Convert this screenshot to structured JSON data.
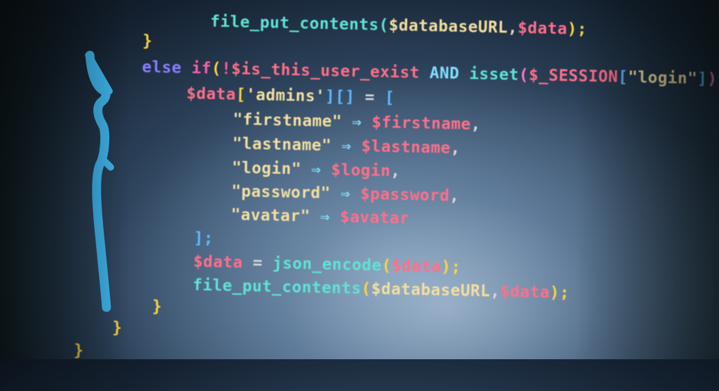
{
  "code": {
    "line0": {
      "a": "    file_put_contents(",
      "b": "$databaseURL",
      "c": ",",
      "d": "$data",
      "e": ");"
    },
    "line1": {
      "a": "}"
    },
    "line2": {
      "else": "else",
      "if": "if",
      "lp": "(",
      "not": "!",
      "v1": "$is_this_user_exist",
      "and": "AND",
      "isset": "isset",
      "lp2": "(",
      "v2": "$_SESSION",
      "lb": "[",
      "s": "\"login\"",
      "rb": "]",
      "rp": ")"
    },
    "line3": {
      "v": "$data",
      "lb": "[",
      "s": "'admins'",
      "rb": "][]",
      "eq": " = ",
      "open": "["
    },
    "line4": {
      "k": "\"firstname\"",
      "arrow": " ⇒ ",
      "v": "$firstname",
      "c": ","
    },
    "line5": {
      "k": "\"lastname\"",
      "arrow": " ⇒ ",
      "v": "$lastname",
      "c": ","
    },
    "line6": {
      "k": "\"login\"",
      "arrow": " ⇒ ",
      "v": "$login",
      "c": ","
    },
    "line7": {
      "k": "\"password\"",
      "arrow": " ⇒ ",
      "v": "$password",
      "c": ","
    },
    "line8": {
      "k": "\"avatar\"",
      "arrow": " ⇒ ",
      "v": "$avatar"
    },
    "line9": {
      "a": "];"
    },
    "line10": {
      "v": "$data",
      "eq": " = ",
      "fn": "json_encode",
      "lp": "(",
      "arg": "$data",
      "rp": ");"
    },
    "line11": {
      "fn": "file_put_contents",
      "lp": "(",
      "a1": "$databaseURL",
      "c": ",",
      "a2": "$data",
      "rp": ");"
    },
    "line12": {
      "a": "}"
    },
    "line13": {
      "a": "}"
    },
    "line14": {
      "a": "}"
    }
  },
  "colors": {
    "marker": "#3fb6ee",
    "background": "#2a3f57"
  }
}
